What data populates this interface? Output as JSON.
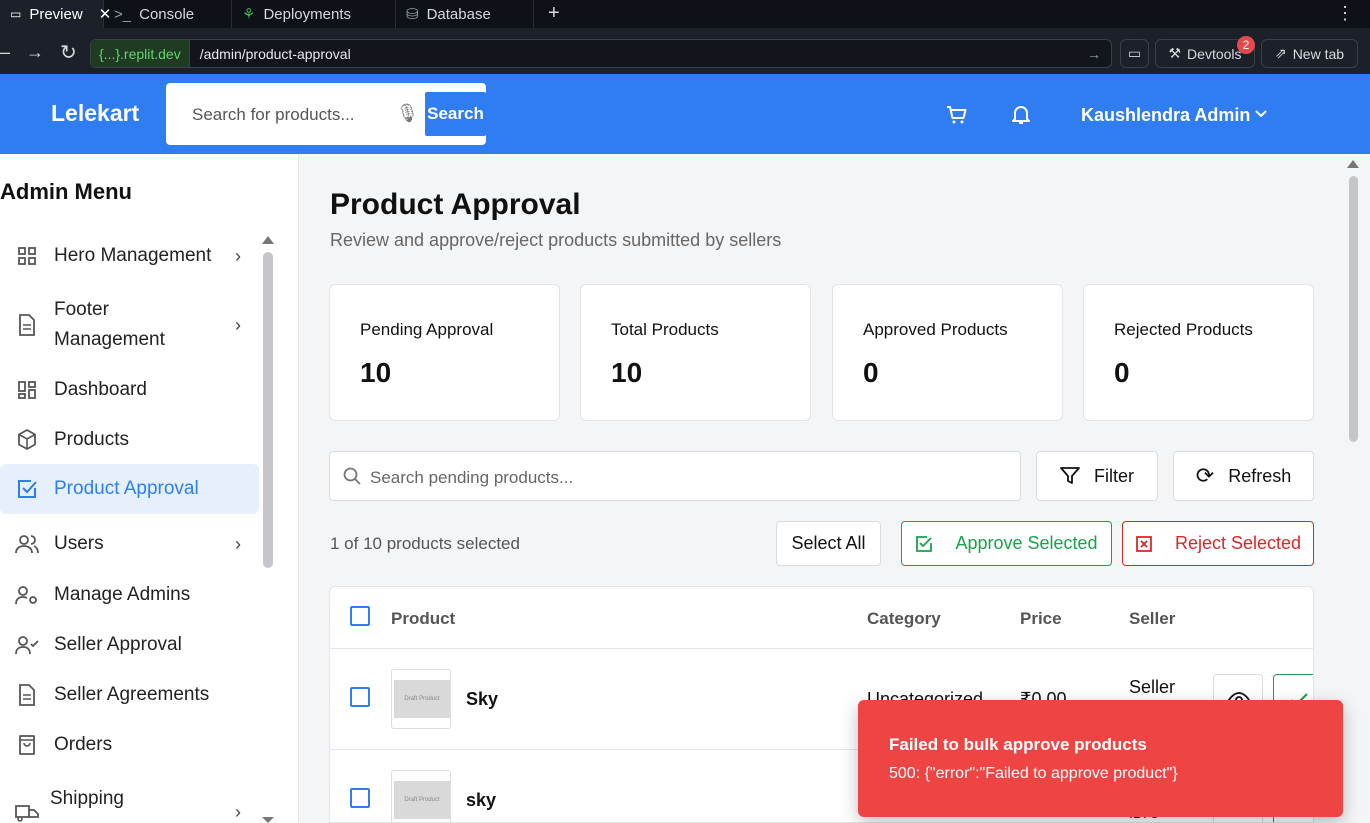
{
  "browser": {
    "tabs": [
      {
        "label": "Preview",
        "icon": "monitor-icon"
      },
      {
        "label": "Console",
        "icon": "terminal-icon"
      },
      {
        "label": "Deployments",
        "icon": "deploy-icon"
      },
      {
        "label": "Database",
        "icon": "database-icon"
      }
    ],
    "url_host": "{...}.replit.dev",
    "url_path": "/admin/product-approval",
    "devtools_label": "Devtools",
    "devtools_badge": "2",
    "newtab_label": "New tab"
  },
  "header": {
    "logo": "Lelekart",
    "search_placeholder": "Search for products...",
    "search_button": "Search",
    "user_name": "Kaushlendra Admin"
  },
  "sidebar": {
    "title": "Admin Menu",
    "items": [
      {
        "label": "Hero Management",
        "icon": "grid-icon",
        "chevron": true
      },
      {
        "label": "Footer",
        "label2": "Management",
        "icon": "document-icon",
        "chevron": true
      },
      {
        "label": "Dashboard",
        "icon": "dashboard-icon",
        "chevron": false
      },
      {
        "label": "Products",
        "icon": "box-icon",
        "chevron": false
      },
      {
        "label": "Product Approval",
        "icon": "check-square-icon",
        "chevron": false,
        "active": true
      },
      {
        "label": "Users",
        "icon": "users-icon",
        "chevron": true
      },
      {
        "label": "Manage Admins",
        "icon": "user-cog-icon",
        "chevron": false
      },
      {
        "label": "Seller Approval",
        "icon": "user-check-icon",
        "chevron": false
      },
      {
        "label": "Seller Agreements",
        "icon": "document-icon",
        "chevron": false
      },
      {
        "label": "Orders",
        "icon": "bag-icon",
        "chevron": false
      },
      {
        "label": "Shipping",
        "icon": "truck-icon",
        "chevron": true
      }
    ]
  },
  "main": {
    "title": "Product Approval",
    "subtitle": "Review and approve/reject products submitted by sellers",
    "stats": [
      {
        "label": "Pending Approval",
        "value": "10"
      },
      {
        "label": "Total Products",
        "value": "10"
      },
      {
        "label": "Approved Products",
        "value": "0"
      },
      {
        "label": "Rejected Products",
        "value": "0"
      }
    ],
    "search_placeholder": "Search pending products...",
    "filter_label": "Filter",
    "refresh_label": "Refresh",
    "selection_info": "1 of 10 products selected",
    "select_all": "Select All",
    "approve_selected": "Approve Selected",
    "reject_selected": "Reject Selected",
    "table": {
      "headers": [
        "Product",
        "Category",
        "Price",
        "Seller"
      ],
      "rows": [
        {
          "name": "Sky",
          "thumb_text": "Draft Product",
          "category": "Uncategorized",
          "price": "₹0.00",
          "seller": "Seller"
        },
        {
          "name": "sky",
          "thumb_text": "Draft Product",
          "category": "",
          "price": "",
          "seller": "ID: 5"
        }
      ]
    }
  },
  "toast": {
    "title": "Failed to bulk approve products",
    "message": "500: {\"error\":\"Failed to approve product\"}"
  },
  "colors": {
    "brand": "#2f7df0",
    "approve": "#16a34a",
    "reject": "#dc2626",
    "toast": "#ef4444"
  }
}
